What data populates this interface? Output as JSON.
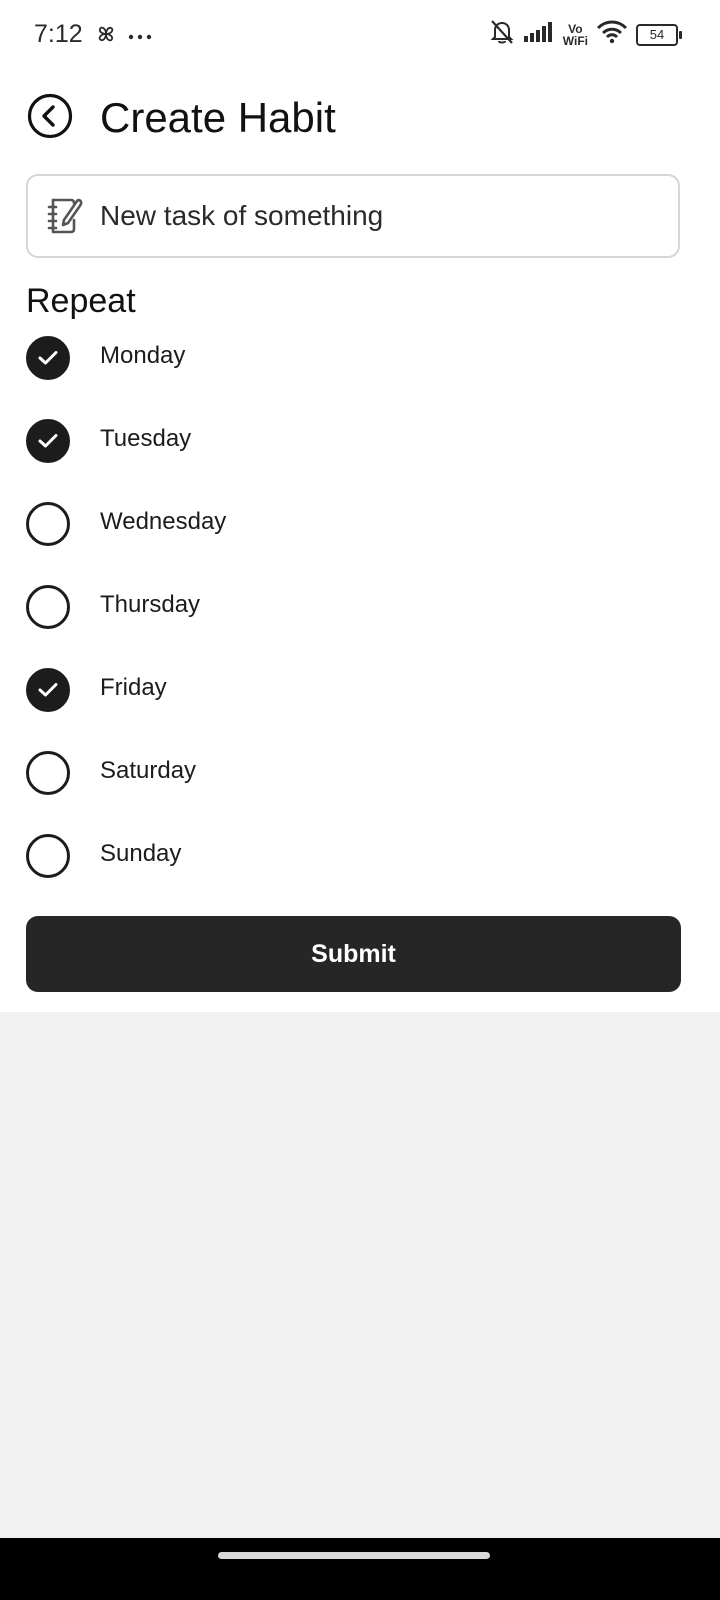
{
  "status_bar": {
    "time": "7:12",
    "vo_label": "Vo",
    "wifi_label": "WiFi",
    "battery": "54",
    "icons": [
      "pinwheel-icon",
      "more-dots-icon",
      "bell-muted-icon",
      "signal-icon",
      "wifi-icon",
      "battery-icon"
    ]
  },
  "header": {
    "title": "Create Habit",
    "back_icon": "back-circle-icon"
  },
  "task": {
    "value": "New task of something",
    "placeholder": "",
    "icon": "notebook-edit-icon"
  },
  "repeat": {
    "label": "Repeat",
    "days": [
      {
        "label": "Monday",
        "checked": true
      },
      {
        "label": "Tuesday",
        "checked": true
      },
      {
        "label": "Wednesday",
        "checked": false
      },
      {
        "label": "Thursday",
        "checked": false
      },
      {
        "label": "Friday",
        "checked": true
      },
      {
        "label": "Saturday",
        "checked": false
      },
      {
        "label": "Sunday",
        "checked": false
      }
    ]
  },
  "submit": {
    "label": "Submit"
  },
  "colors": {
    "primary": "#262626",
    "background": "#ffffff",
    "lower_background": "#f1f1f1",
    "border": "#d6d6d6"
  }
}
